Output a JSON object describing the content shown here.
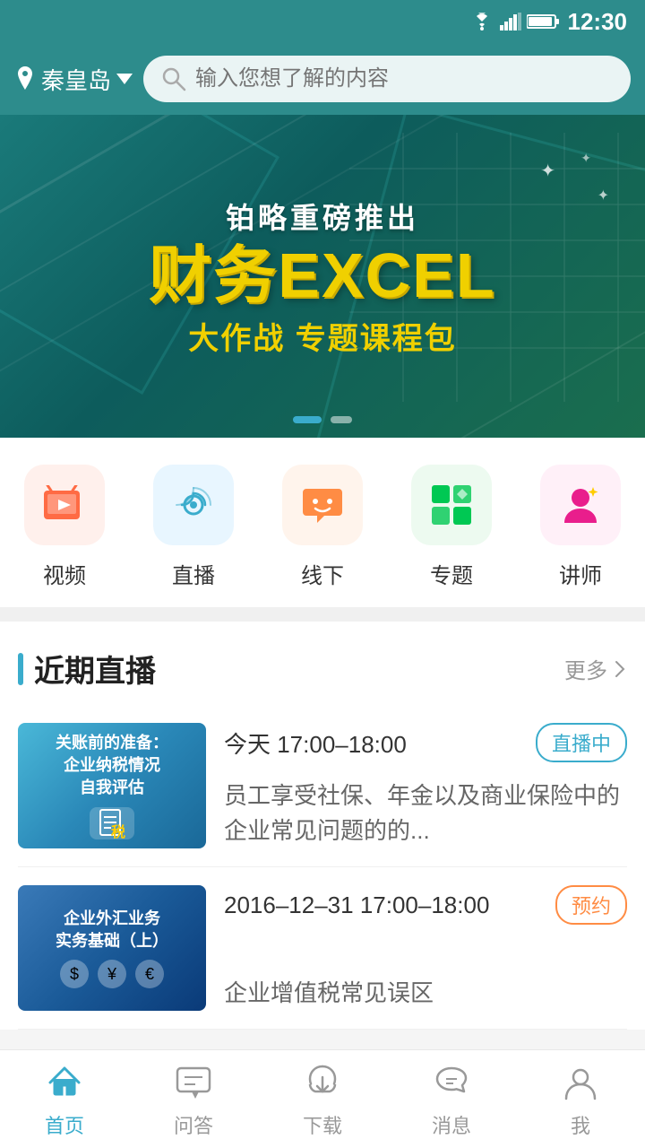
{
  "statusBar": {
    "time": "12:30"
  },
  "topBar": {
    "location": "秦皇岛",
    "searchPlaceholder": "输入您想了解的内容"
  },
  "banner": {
    "subtitle": "铂略重磅推出",
    "title": "财务EXCEL",
    "desc1": "大作战",
    "desc2": "专题课程包",
    "dots": [
      true,
      false
    ]
  },
  "categories": [
    {
      "id": "video",
      "label": "视频",
      "iconType": "video"
    },
    {
      "id": "live",
      "label": "直播",
      "iconType": "live"
    },
    {
      "id": "offline",
      "label": "线下",
      "iconType": "offline"
    },
    {
      "id": "topic",
      "label": "专题",
      "iconType": "topic"
    },
    {
      "id": "teacher",
      "label": "讲师",
      "iconType": "teacher"
    }
  ],
  "liveSection": {
    "title": "近期直播",
    "moreLabel": "更多",
    "items": [
      {
        "id": "live1",
        "thumb_text": "关账前的准备：企业纳税情况自我评估",
        "time": "今天 17:00–18:00",
        "badge": "直播中",
        "badgeType": "live",
        "desc": "员工享受社保、年金以及商业保险中的企业常见问题的的..."
      },
      {
        "id": "live2",
        "thumb_text": "企业外汇业务实务基础（上）",
        "time": "2016–12–31  17:00–18:00",
        "badge": "预约",
        "badgeType": "reserve",
        "desc": "企业增值税常见误区"
      }
    ]
  },
  "bottomNav": [
    {
      "id": "home",
      "label": "首页",
      "active": true
    },
    {
      "id": "qa",
      "label": "问答",
      "active": false
    },
    {
      "id": "download",
      "label": "下载",
      "active": false
    },
    {
      "id": "message",
      "label": "消息",
      "active": false
    },
    {
      "id": "me",
      "label": "我",
      "active": false
    }
  ]
}
